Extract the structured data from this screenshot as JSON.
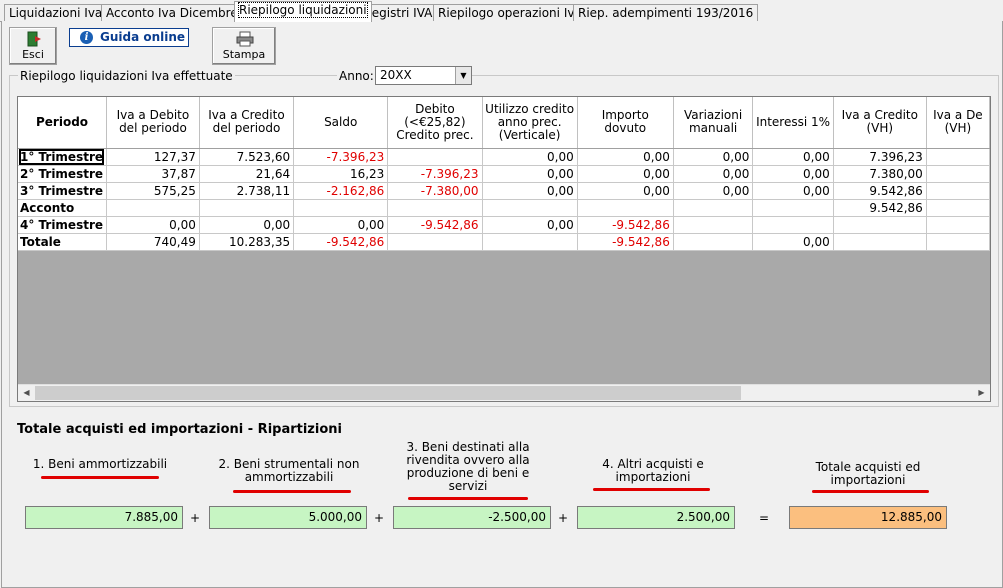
{
  "tabs": [
    {
      "label": "Liquidazioni Iva"
    },
    {
      "label": "Acconto Iva Dicembre"
    },
    {
      "label": "Riepilogo liquidazioni"
    },
    {
      "label": "Registri IVA"
    },
    {
      "label": "Riepilogo operazioni Iva"
    },
    {
      "label": "Riep. adempimenti 193/2016"
    }
  ],
  "toolbar": {
    "exit_label": "Esci",
    "guide_label": "Guida online",
    "print_label": "Stampa"
  },
  "group": {
    "title": "Riepilogo liquidazioni Iva effettuate",
    "year_label": "Anno:",
    "year_value": "20XX"
  },
  "grid": {
    "columns": [
      "Periodo",
      "Iva a Debito del periodo",
      "Iva a Credito del periodo",
      "Saldo",
      "Debito (<€25,82) Credito prec.",
      "Utilizzo credito anno prec. (Verticale)",
      "Importo dovuto",
      "Variazioni manuali",
      "Interessi 1%",
      "Iva a Credito (VH)",
      "Iva a De (VH)"
    ],
    "rows": [
      {
        "period": "1° Trimestre",
        "cells": [
          "127,37",
          "7.523,60",
          "-7.396,23",
          "",
          "0,00",
          "0,00",
          "0,00",
          "0,00",
          "7.396,23",
          ""
        ]
      },
      {
        "period": "2° Trimestre",
        "cells": [
          "37,87",
          "21,64",
          "16,23",
          "-7.396,23",
          "0,00",
          "0,00",
          "0,00",
          "0,00",
          "7.380,00",
          ""
        ]
      },
      {
        "period": "3° Trimestre",
        "cells": [
          "575,25",
          "2.738,11",
          "-2.162,86",
          "-7.380,00",
          "0,00",
          "0,00",
          "0,00",
          "0,00",
          "9.542,86",
          ""
        ]
      },
      {
        "period": "Acconto",
        "cells": [
          "",
          "",
          "",
          "",
          "",
          "",
          "",
          "",
          "9.542,86",
          ""
        ]
      },
      {
        "period": "4° Trimestre",
        "cells": [
          "0,00",
          "0,00",
          "0,00",
          "-9.542,86",
          "0,00",
          "-9.542,86",
          "",
          "",
          "",
          ""
        ]
      },
      {
        "period": "Totale",
        "cells": [
          "740,49",
          "10.283,35",
          "-9.542,86",
          "",
          "",
          "-9.542,86",
          "",
          "0,00",
          "",
          ""
        ]
      }
    ]
  },
  "bottom": {
    "title": "Totale acquisti ed importazioni - Ripartizioni",
    "col1_label": "1. Beni ammortizzabili",
    "col2_label": "2. Beni strumentali non ammortizzabili",
    "col3_label": "3. Beni destinati alla rivendita ovvero alla produzione di beni e servizi",
    "col4_label": "4. Altri acquisti e importazioni",
    "total_label": "Totale acquisti ed importazioni",
    "col1_value": "7.885,00",
    "col2_value": "5.000,00",
    "col3_value": "-2.500,00",
    "col4_value": "2.500,00",
    "total_value": "12.885,00",
    "plus_sign": "+",
    "equals_sign": "="
  },
  "colors": {
    "negative": "#e00000",
    "highlight_underline": "#e00000",
    "field_green": "#c7f5c3",
    "field_total": "#fbbf7f"
  }
}
